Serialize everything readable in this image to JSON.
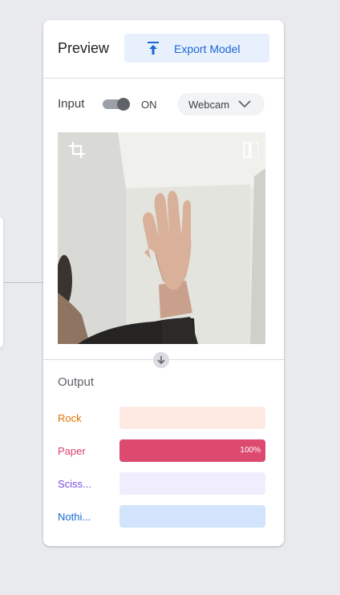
{
  "panel": {
    "title": "Preview",
    "export_label": "Export Model"
  },
  "input": {
    "label": "Input",
    "toggle_text": "ON",
    "toggle_on": true,
    "source_value": "Webcam"
  },
  "output": {
    "title": "Output",
    "classes": [
      {
        "label": "Rock",
        "confidence": 0,
        "percent_text": "",
        "label_color": "#e37400",
        "track_color": "#fdebe3",
        "fill_color": "#fbcfb9"
      },
      {
        "label": "Paper",
        "confidence": 1.0,
        "percent_text": "100%",
        "label_color": "#d6436e",
        "track_color": "#fce8ee",
        "fill_color": "#dc4a70"
      },
      {
        "label": "Sciss...",
        "confidence": 0,
        "percent_text": "",
        "label_color": "#7b4ee0",
        "track_color": "#f0eefd",
        "fill_color": "#c8b8f5"
      },
      {
        "label": "Nothi...",
        "confidence": 0,
        "percent_text": "",
        "label_color": "#1967d2",
        "track_color": "#d2e3fc",
        "fill_color": "#8ab4f8"
      }
    ]
  },
  "icons": {
    "export": "upload-icon",
    "dropdown": "chevron-down-icon",
    "crop": "crop-icon",
    "mirror": "flip-icon",
    "down_arrow": "arrow-down-icon"
  },
  "colors": {
    "accent": "#1967d2",
    "export_bg": "#e8f0fe",
    "background": "#e8eaed"
  }
}
